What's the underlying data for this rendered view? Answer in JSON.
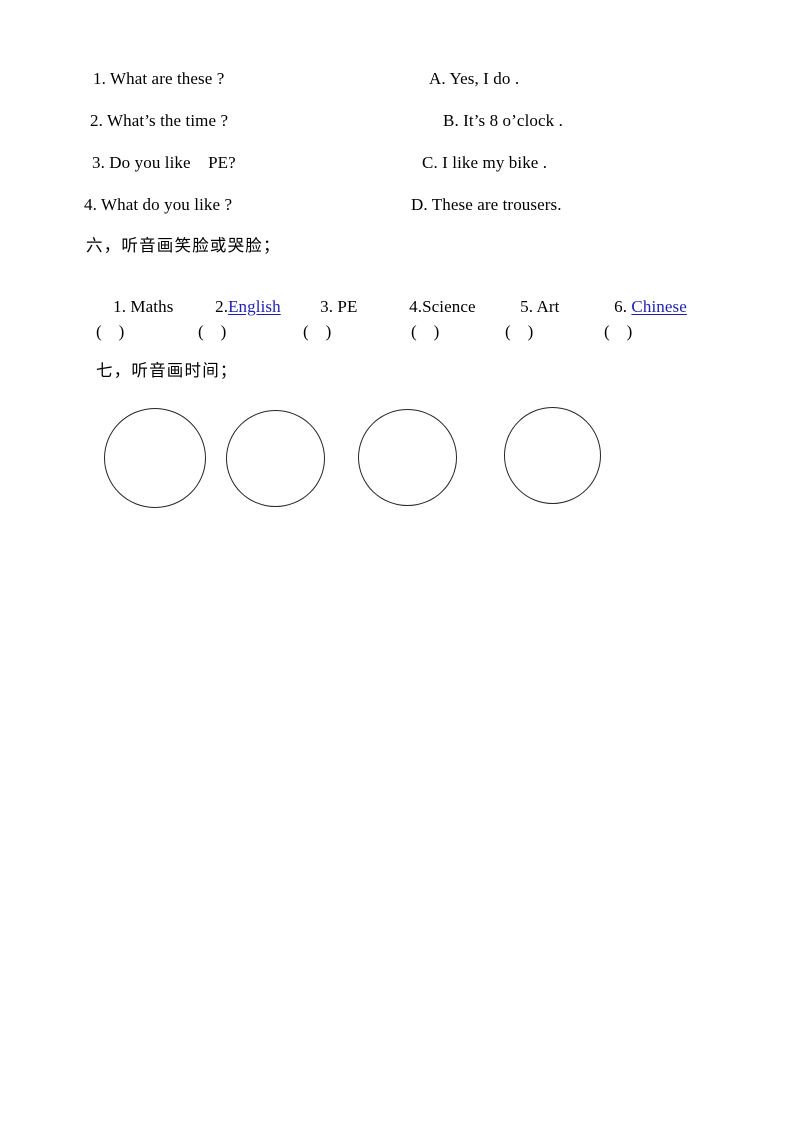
{
  "document": {
    "page_background": "#ffffff",
    "text_color": "#000000",
    "link_color": "#1f1fb4"
  },
  "matching_exercise": {
    "questions": [
      {
        "number": "1.",
        "text": "What are these ?",
        "full": "1. What are these ?"
      },
      {
        "number": "2.",
        "text": "What’s the time ?",
        "full": "2. What’s the time ?"
      },
      {
        "number": "3.",
        "text": "Do you like    PE?",
        "full": "3. Do you like    PE?"
      },
      {
        "number": "4.",
        "text": "What do you like ?",
        "full": "4. What do you like ?"
      }
    ],
    "answers": [
      {
        "letter": "A.",
        "text": "Yes, I do .",
        "full": "A. Yes, I do ."
      },
      {
        "letter": "B.",
        "text": "It’s 8 o’clock .",
        "full": "B. It’s 8 o’clock ."
      },
      {
        "letter": "C.",
        "text": "I like my bike .",
        "full": "C. I like my bike ."
      },
      {
        "letter": "D.",
        "text": "These are trousers.",
        "full": "D. These are trousers."
      }
    ]
  },
  "section_six": {
    "heading": "六，听音画笑脸或哭脸；",
    "subjects": [
      {
        "number": "1.",
        "label": " Maths",
        "is_link": false,
        "full": "1. Maths"
      },
      {
        "number": "2.",
        "label": "English",
        "is_link": true,
        "full": "2.English"
      },
      {
        "number": "3.",
        "label": " PE",
        "is_link": false,
        "full": "3. PE"
      },
      {
        "number": "4.",
        "label": "Science",
        "is_link": false,
        "full": "4.Science"
      },
      {
        "number": "5.",
        "label": " Art",
        "is_link": false,
        "full": "5. Art"
      },
      {
        "number": "6.",
        "label": "Chinese",
        "is_link": true,
        "full": "6. Chinese"
      }
    ],
    "answer_brackets": [
      {
        "text": "(    )"
      },
      {
        "text": "(    )"
      },
      {
        "text": "(    )"
      },
      {
        "text": "(    )"
      },
      {
        "text": "(    )"
      },
      {
        "text": "(    )"
      }
    ]
  },
  "section_seven": {
    "heading": "七，听音画时间；",
    "clock_faces": [
      {
        "index": 1
      },
      {
        "index": 2
      },
      {
        "index": 3
      },
      {
        "index": 4
      }
    ]
  }
}
